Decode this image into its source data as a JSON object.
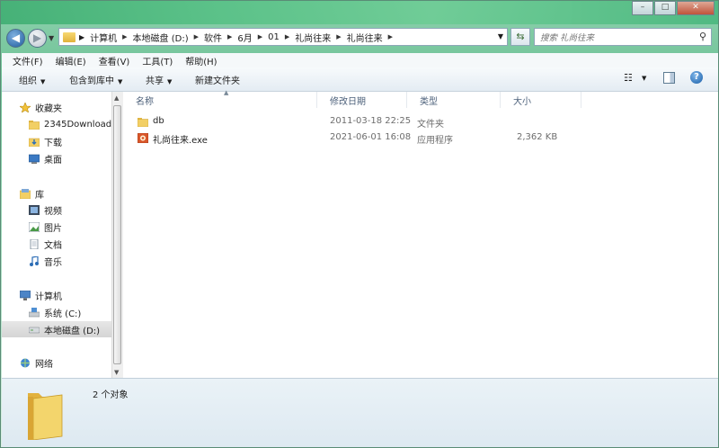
{
  "window": {
    "controls": {
      "minimize": "–",
      "maximize": "□",
      "close": "✕"
    }
  },
  "navigation": {
    "breadcrumb": [
      "计算机",
      "本地磁盘 (D:)",
      "软件",
      "6月",
      "01",
      "礼尚往来",
      "礼尚往来"
    ],
    "search_placeholder": "搜索 礼尚往来"
  },
  "menu": [
    "文件(F)",
    "编辑(E)",
    "查看(V)",
    "工具(T)",
    "帮助(H)"
  ],
  "toolbar": {
    "organize": "组织",
    "include_in_library": "包含到库中",
    "share": "共享",
    "new_folder": "新建文件夹"
  },
  "sidebar": {
    "favorites": {
      "title": "收藏夹",
      "items": [
        "2345Download",
        "下载",
        "桌面"
      ]
    },
    "libraries": {
      "title": "库",
      "items": [
        "视频",
        "图片",
        "文档",
        "音乐"
      ]
    },
    "computer": {
      "title": "计算机",
      "items": [
        "系统 (C:)",
        "本地磁盘 (D:)"
      ]
    },
    "network": {
      "title": "网络"
    },
    "selected": "本地磁盘 (D:)"
  },
  "columns": {
    "name": "名称",
    "modified": "修改日期",
    "type": "类型",
    "size": "大小"
  },
  "files": [
    {
      "name": "db",
      "modified": "2011-03-18 22:25",
      "type": "文件夹",
      "size": "",
      "icon": "folder-icon"
    },
    {
      "name": "礼尚往来.exe",
      "modified": "2021-06-01 16:08",
      "type": "应用程序",
      "size": "2,362 KB",
      "icon": "app-icon"
    }
  ],
  "details": {
    "count": "2 个对象"
  },
  "colors": {
    "accent": "#6cc195",
    "folder": "#f0c853",
    "selection": "#d9d9d9"
  }
}
